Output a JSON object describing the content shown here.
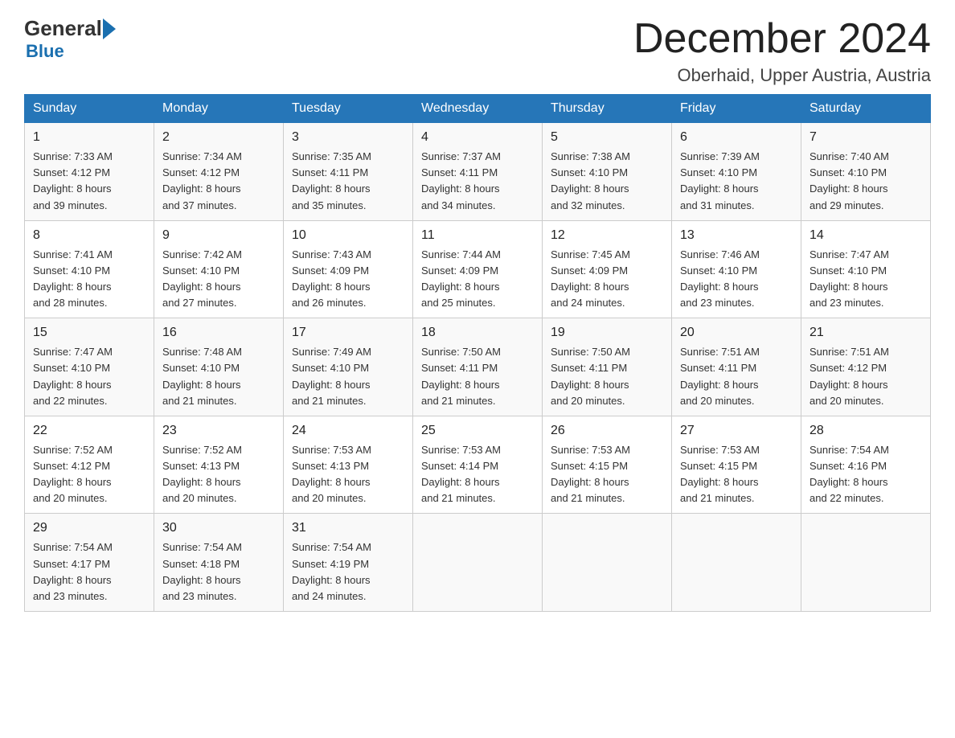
{
  "header": {
    "logo_general": "General",
    "logo_blue": "Blue",
    "month_title": "December 2024",
    "location": "Oberhaid, Upper Austria, Austria"
  },
  "weekdays": [
    "Sunday",
    "Monday",
    "Tuesday",
    "Wednesday",
    "Thursday",
    "Friday",
    "Saturday"
  ],
  "weeks": [
    [
      {
        "day": "1",
        "sunrise": "7:33 AM",
        "sunset": "4:12 PM",
        "daylight": "8 hours and 39 minutes."
      },
      {
        "day": "2",
        "sunrise": "7:34 AM",
        "sunset": "4:12 PM",
        "daylight": "8 hours and 37 minutes."
      },
      {
        "day": "3",
        "sunrise": "7:35 AM",
        "sunset": "4:11 PM",
        "daylight": "8 hours and 35 minutes."
      },
      {
        "day": "4",
        "sunrise": "7:37 AM",
        "sunset": "4:11 PM",
        "daylight": "8 hours and 34 minutes."
      },
      {
        "day": "5",
        "sunrise": "7:38 AM",
        "sunset": "4:10 PM",
        "daylight": "8 hours and 32 minutes."
      },
      {
        "day": "6",
        "sunrise": "7:39 AM",
        "sunset": "4:10 PM",
        "daylight": "8 hours and 31 minutes."
      },
      {
        "day": "7",
        "sunrise": "7:40 AM",
        "sunset": "4:10 PM",
        "daylight": "8 hours and 29 minutes."
      }
    ],
    [
      {
        "day": "8",
        "sunrise": "7:41 AM",
        "sunset": "4:10 PM",
        "daylight": "8 hours and 28 minutes."
      },
      {
        "day": "9",
        "sunrise": "7:42 AM",
        "sunset": "4:10 PM",
        "daylight": "8 hours and 27 minutes."
      },
      {
        "day": "10",
        "sunrise": "7:43 AM",
        "sunset": "4:09 PM",
        "daylight": "8 hours and 26 minutes."
      },
      {
        "day": "11",
        "sunrise": "7:44 AM",
        "sunset": "4:09 PM",
        "daylight": "8 hours and 25 minutes."
      },
      {
        "day": "12",
        "sunrise": "7:45 AM",
        "sunset": "4:09 PM",
        "daylight": "8 hours and 24 minutes."
      },
      {
        "day": "13",
        "sunrise": "7:46 AM",
        "sunset": "4:10 PM",
        "daylight": "8 hours and 23 minutes."
      },
      {
        "day": "14",
        "sunrise": "7:47 AM",
        "sunset": "4:10 PM",
        "daylight": "8 hours and 23 minutes."
      }
    ],
    [
      {
        "day": "15",
        "sunrise": "7:47 AM",
        "sunset": "4:10 PM",
        "daylight": "8 hours and 22 minutes."
      },
      {
        "day": "16",
        "sunrise": "7:48 AM",
        "sunset": "4:10 PM",
        "daylight": "8 hours and 21 minutes."
      },
      {
        "day": "17",
        "sunrise": "7:49 AM",
        "sunset": "4:10 PM",
        "daylight": "8 hours and 21 minutes."
      },
      {
        "day": "18",
        "sunrise": "7:50 AM",
        "sunset": "4:11 PM",
        "daylight": "8 hours and 21 minutes."
      },
      {
        "day": "19",
        "sunrise": "7:50 AM",
        "sunset": "4:11 PM",
        "daylight": "8 hours and 20 minutes."
      },
      {
        "day": "20",
        "sunrise": "7:51 AM",
        "sunset": "4:11 PM",
        "daylight": "8 hours and 20 minutes."
      },
      {
        "day": "21",
        "sunrise": "7:51 AM",
        "sunset": "4:12 PM",
        "daylight": "8 hours and 20 minutes."
      }
    ],
    [
      {
        "day": "22",
        "sunrise": "7:52 AM",
        "sunset": "4:12 PM",
        "daylight": "8 hours and 20 minutes."
      },
      {
        "day": "23",
        "sunrise": "7:52 AM",
        "sunset": "4:13 PM",
        "daylight": "8 hours and 20 minutes."
      },
      {
        "day": "24",
        "sunrise": "7:53 AM",
        "sunset": "4:13 PM",
        "daylight": "8 hours and 20 minutes."
      },
      {
        "day": "25",
        "sunrise": "7:53 AM",
        "sunset": "4:14 PM",
        "daylight": "8 hours and 21 minutes."
      },
      {
        "day": "26",
        "sunrise": "7:53 AM",
        "sunset": "4:15 PM",
        "daylight": "8 hours and 21 minutes."
      },
      {
        "day": "27",
        "sunrise": "7:53 AM",
        "sunset": "4:15 PM",
        "daylight": "8 hours and 21 minutes."
      },
      {
        "day": "28",
        "sunrise": "7:54 AM",
        "sunset": "4:16 PM",
        "daylight": "8 hours and 22 minutes."
      }
    ],
    [
      {
        "day": "29",
        "sunrise": "7:54 AM",
        "sunset": "4:17 PM",
        "daylight": "8 hours and 23 minutes."
      },
      {
        "day": "30",
        "sunrise": "7:54 AM",
        "sunset": "4:18 PM",
        "daylight": "8 hours and 23 minutes."
      },
      {
        "day": "31",
        "sunrise": "7:54 AM",
        "sunset": "4:19 PM",
        "daylight": "8 hours and 24 minutes."
      },
      null,
      null,
      null,
      null
    ]
  ],
  "labels": {
    "sunrise": "Sunrise:",
    "sunset": "Sunset:",
    "daylight": "Daylight:"
  }
}
